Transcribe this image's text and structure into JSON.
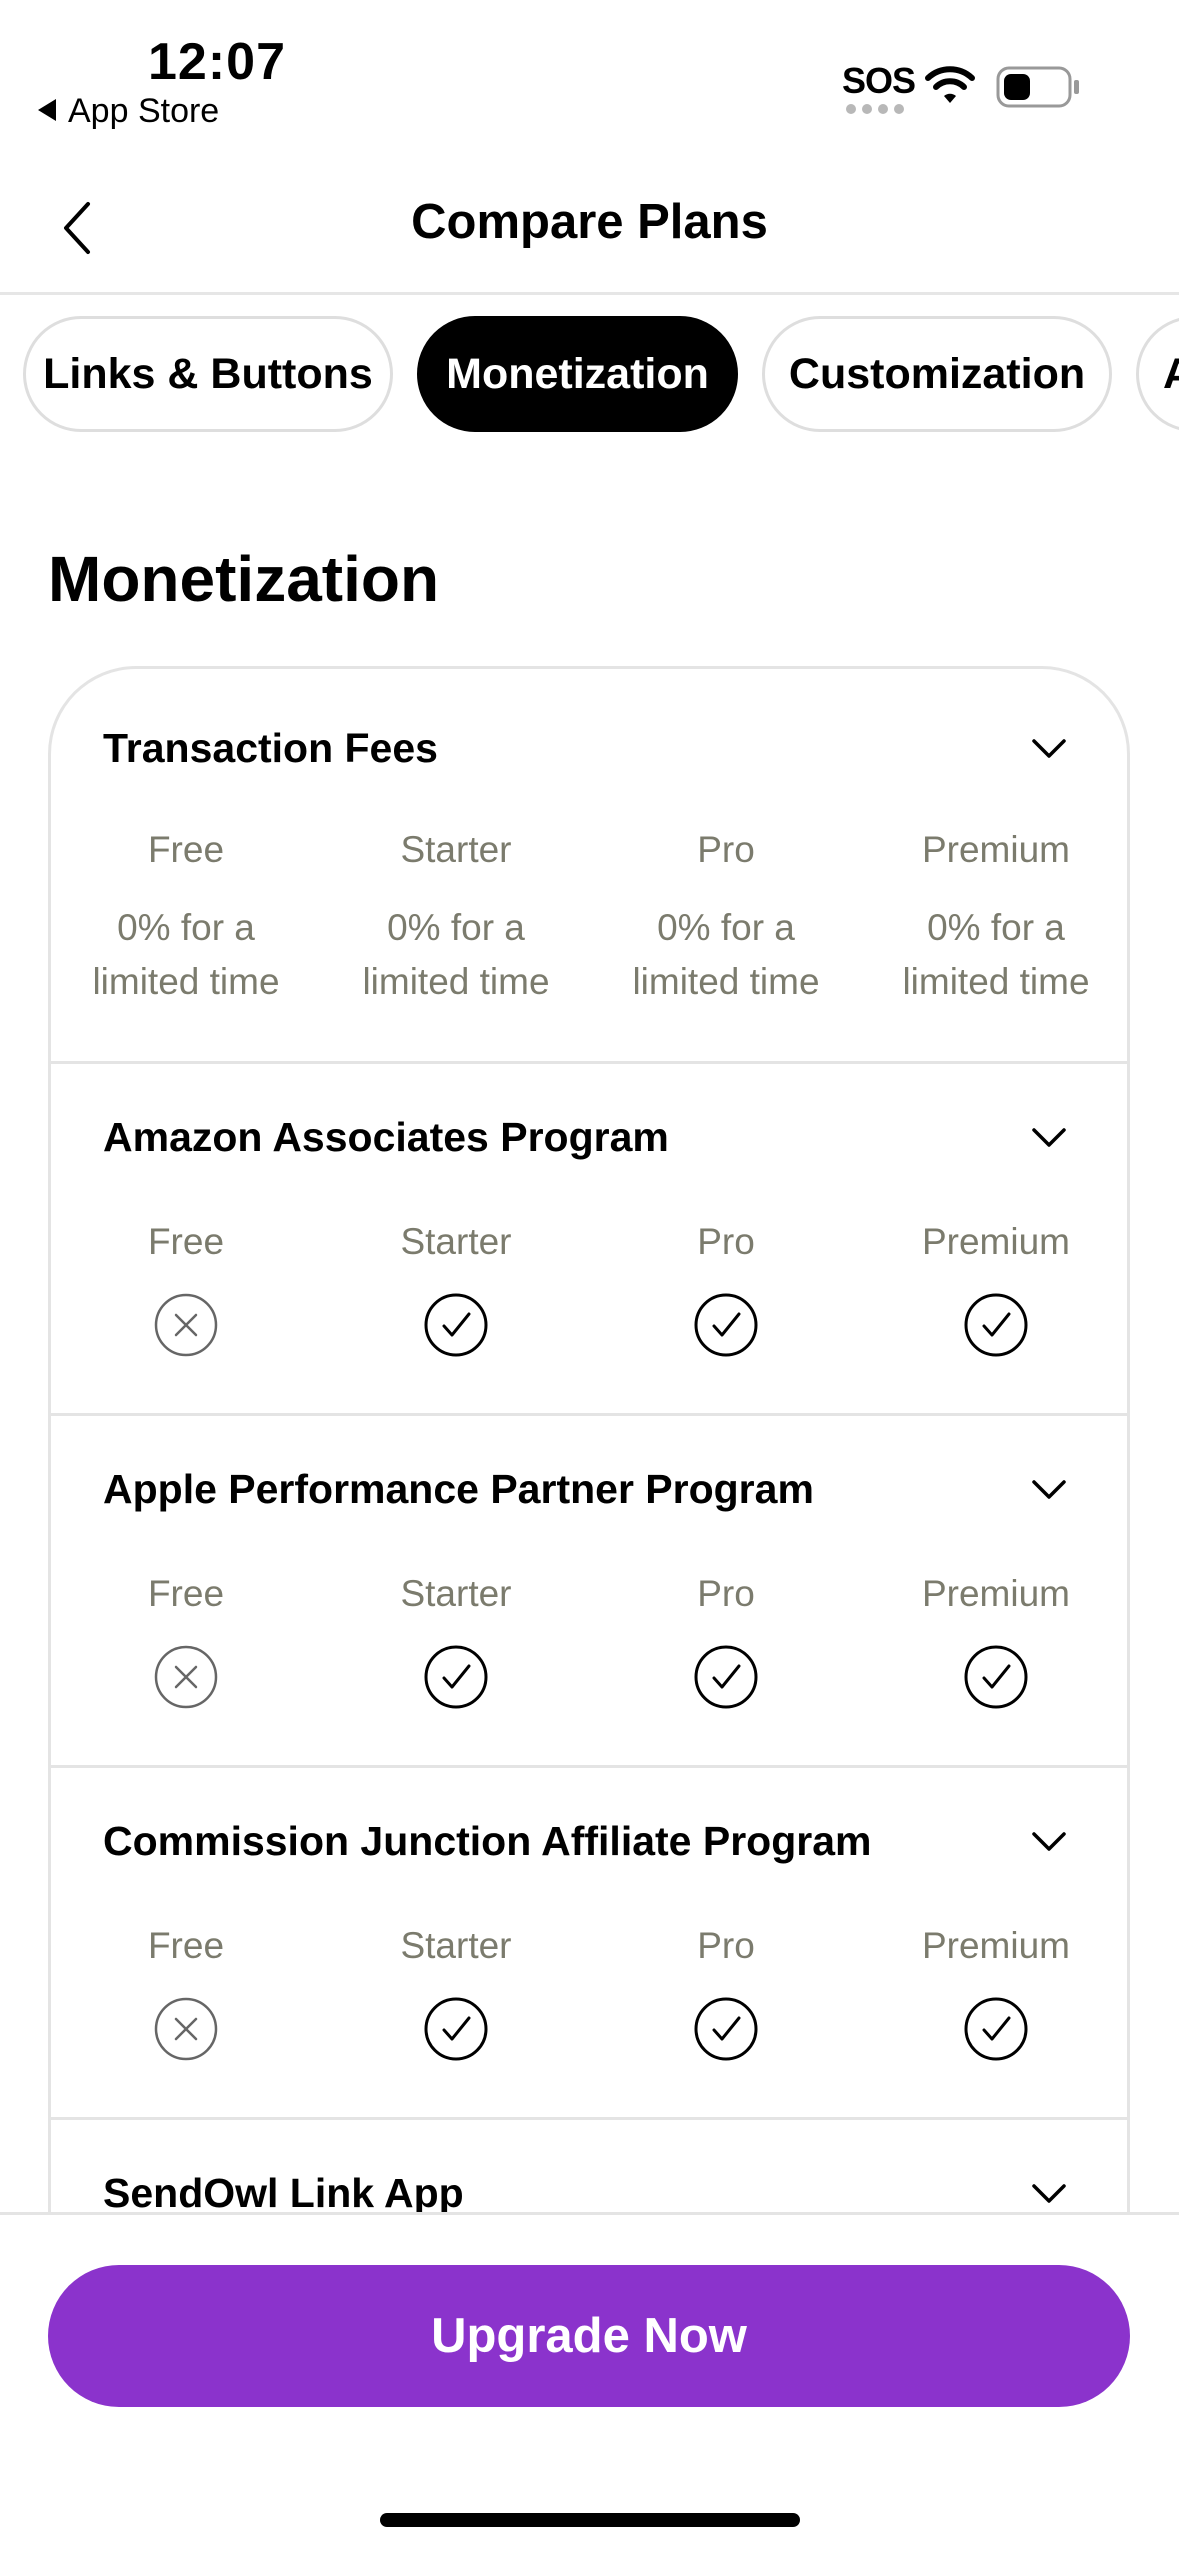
{
  "status_bar": {
    "time": "12:07",
    "back_app": "App Store",
    "sos": "SOS",
    "icons": [
      "wifi-icon",
      "battery-icon"
    ]
  },
  "nav": {
    "title": "Compare Plans",
    "back_icon": "chevron-left-icon"
  },
  "tabs": [
    {
      "label": "Links & Buttons",
      "active": false
    },
    {
      "label": "Monetization",
      "active": true
    },
    {
      "label": "Customization",
      "active": false
    },
    {
      "label": "A",
      "active": false
    }
  ],
  "section_title": "Monetization",
  "plans": [
    "Free",
    "Starter",
    "Pro",
    "Premium"
  ],
  "features": [
    {
      "title": "Transaction Fees",
      "type": "text",
      "values": [
        [
          "0% for a",
          "limited time"
        ],
        [
          "0% for a",
          "limited time"
        ],
        [
          "0% for a",
          "limited time"
        ],
        [
          "0% for a",
          "limited time"
        ]
      ]
    },
    {
      "title": "Amazon Associates Program",
      "type": "check",
      "values": [
        false,
        true,
        true,
        true
      ]
    },
    {
      "title": "Apple Performance Partner Program",
      "type": "check",
      "values": [
        false,
        true,
        true,
        true
      ]
    },
    {
      "title": "Commission Junction Affiliate Program",
      "type": "check",
      "values": [
        false,
        true,
        true,
        true
      ]
    },
    {
      "title": "SendOwl Link App",
      "type": "check",
      "values": []
    }
  ],
  "cta": {
    "label": "Upgrade Now",
    "color": "#8b33cc"
  },
  "colors": {
    "accent": "#8b33cc",
    "plan_label": "#7b7b6d",
    "active_tab": "#000000"
  }
}
